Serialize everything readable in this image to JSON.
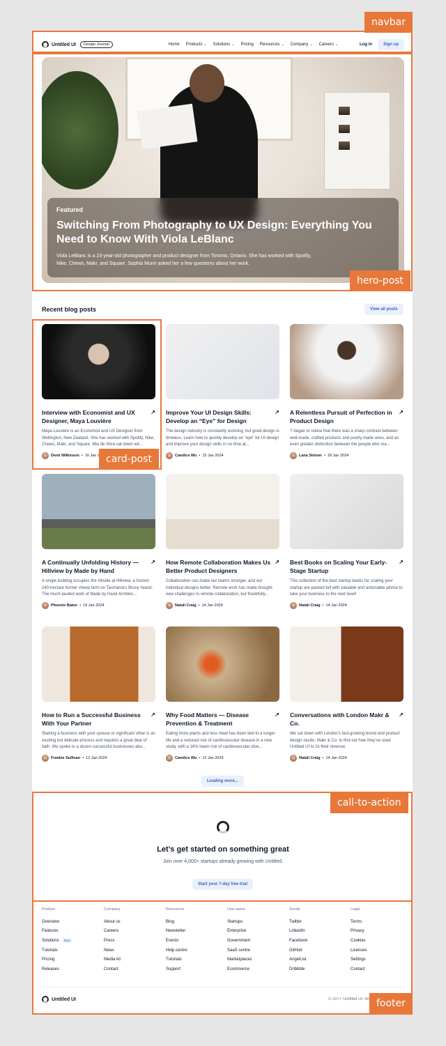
{
  "annotations": {
    "navbar": "navbar",
    "hero": "hero-post",
    "card": "card-post",
    "cta": "call-to-action",
    "footer": "footer"
  },
  "nav": {
    "brand": "Untitled UI",
    "badge": "Design Journal",
    "items": [
      "Home",
      "Products",
      "Solutions",
      "Pricing",
      "Resources",
      "Company",
      "Careers"
    ],
    "login": "Log in",
    "signup": "Sign up"
  },
  "hero": {
    "tag": "Featured",
    "title": "Switching From Photography to UX Design: Everything You Need to Know With Viola LeBlanc",
    "excerpt": "Viola LeBlanc is a 23-year-old photographer and product designer from Toronto, Ontario. She has worked with Spotify, Nike, Chews, Makr, and Square. Sophia Munn asked her a few questions about her work."
  },
  "recent": {
    "title": "Recent blog posts",
    "view_all": "View all posts",
    "load_more": "Loading more..."
  },
  "posts": [
    {
      "title": "Interview with Economist and UX Designer, Maya Louvière",
      "excerpt": "Maya Louvière is an Economist and UX Designer from Wellington, New Zealand. She has worked with Spotify, Nike, Chews, Makr, and Square. Mia de Silva sat down wit...",
      "author": "Demi Wilkinson",
      "date": "16 Jan 2024"
    },
    {
      "title": "Improve Your UI Design Skills: Develop an “Eye” for Design",
      "excerpt": "The design industry is constantly evolving, but good design is timeless. Learn how to quickly develop an “eye” for UI design and improve your design skills in no time at...",
      "author": "Candice Wu",
      "date": "15 Jan 2024"
    },
    {
      "title": "A Relentless Pursuit of Perfection in Product Design",
      "excerpt": "“I began to notice that there was a sharp contrast between well-made, crafted products and poorly made ones, and an even greater distinction between the people who ma...",
      "author": "Lana Steiner",
      "date": "18 Jan 2024"
    },
    {
      "title": "A Continually Unfolding History — Hillview by Made by Hand",
      "excerpt": "A single building occupies the hillside at Hillview, a historic 240-hectare former sheep farm on Tasmania's Bruny Island. The much-lauded work of Made by Hand Architec...",
      "author": "Phoenix Baker",
      "date": "19 Jan 2024"
    },
    {
      "title": "How Remote Collaboration Makes Us Better Product Designers",
      "excerpt": "Collaboration can make our teams stronger, and our individual designs better. Remote work has made brought new challenges to remote collaboration, but thankfully...",
      "author": "Natali Craig",
      "date": "14 Jan 2024"
    },
    {
      "title": "Best Books on Scaling Your Early-Stage Startup",
      "excerpt": "This collection of the best startup books for scaling your startup are packed full with valuable and actionable advice to take your business to the next level!",
      "author": "Natali Craig",
      "date": "14 Jan 2024"
    },
    {
      "title": "How to Run a Successful Business With Your Partner",
      "excerpt": "Starting a business with your spouse or significant other is an exciting but delicate process and requires a great deal of faith. We spoke to a dozen successful businesses abo...",
      "author": "Frankie Sullivan",
      "date": "12 Jan 2024"
    },
    {
      "title": "Why Food Matters — Disease Prevention & Treatment",
      "excerpt": "Eating more plants and less meat has been tied to a longer life and a reduced risk of cardiovascular disease in a new study, with a 16% lower risk of cardiovascular dise...",
      "author": "Candice Wu",
      "date": "12 Jan 2024"
    },
    {
      "title": "Conversations with London Makr & Co.",
      "excerpt": "We sat down with London’s fast-growing brand and product design studio, Makr & Co. to find out how they’ve used Untitled UI to 2x their revenue.",
      "author": "Natali Craig",
      "date": "14 Jan 2024"
    }
  ],
  "cta": {
    "title": "Let’s get started on something great",
    "subtitle": "Join over 4,000+ startups already growing with Untitled.",
    "button": "Start your 7-day free trial"
  },
  "footer": {
    "columns": [
      {
        "head": "Product",
        "links": [
          "Overview",
          "Features",
          "Solutions",
          "Tutorials",
          "Pricing",
          "Releases"
        ],
        "badge": "New"
      },
      {
        "head": "Company",
        "links": [
          "About us",
          "Careers",
          "Press",
          "News",
          "Media kit",
          "Contact"
        ]
      },
      {
        "head": "Resources",
        "links": [
          "Blog",
          "Newsletter",
          "Events",
          "Help centre",
          "Tutorials",
          "Support"
        ]
      },
      {
        "head": "Use cases",
        "links": [
          "Startups",
          "Enterprise",
          "Government",
          "SaaS centre",
          "Marketplaces",
          "Ecommerce"
        ]
      },
      {
        "head": "Social",
        "links": [
          "Twitter",
          "LinkedIn",
          "Facebook",
          "GitHub",
          "AngelList",
          "Dribbble"
        ]
      },
      {
        "head": "Legal",
        "links": [
          "Terms",
          "Privacy",
          "Cookies",
          "Licenses",
          "Settings",
          "Contact"
        ]
      }
    ],
    "brand": "Untitled UI",
    "copyright": "© 2077 Untitled UI. All rights reserved."
  },
  "colors": {
    "accent": "#e8783a",
    "button_bg": "#eaf0fb",
    "button_text": "#3b63c4"
  }
}
